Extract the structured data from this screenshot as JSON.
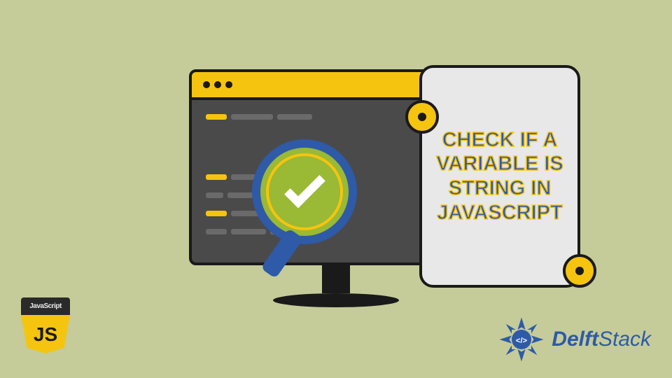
{
  "main_title": "CHECK IF A VARIABLE IS STRING IN JAVASCRIPT",
  "js_logo": {
    "label": "JavaScript",
    "short": "JS"
  },
  "brand": {
    "name_bold": "Delft",
    "name_light": "Stack"
  },
  "colors": {
    "background": "#c5cc99",
    "accent_yellow": "#f5c40f",
    "accent_blue": "#2e5aa8",
    "dark": "#1a1a1a"
  }
}
